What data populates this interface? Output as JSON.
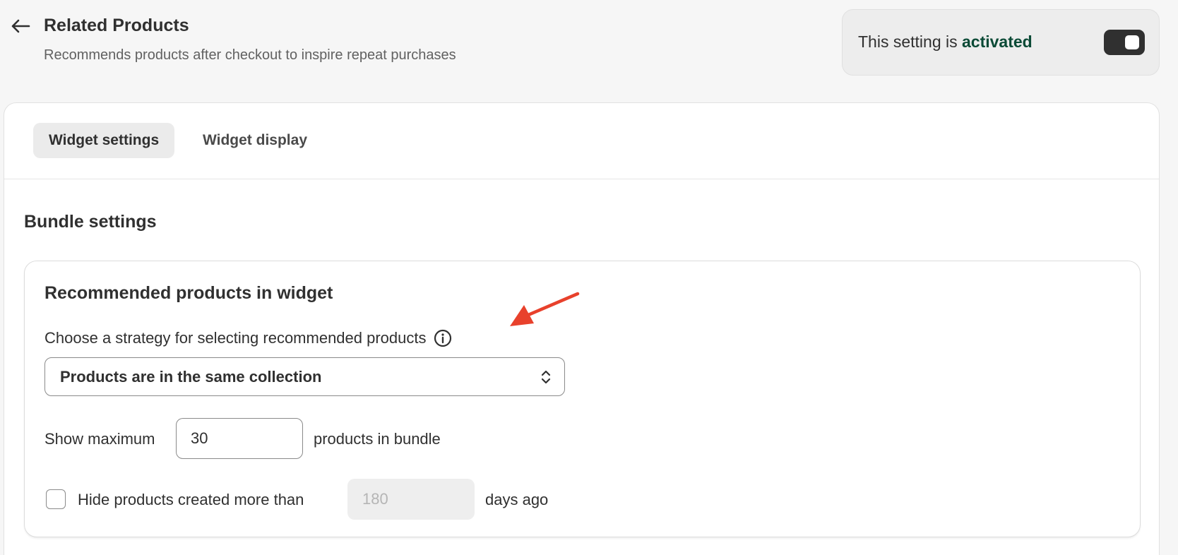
{
  "header": {
    "back_icon": "arrow-left-icon",
    "title": "Related Products",
    "subtitle": "Recommends products after checkout to inspire repeat purchases"
  },
  "status": {
    "text_prefix": "This setting is ",
    "text_strong": "activated",
    "toggle_on": true
  },
  "tabs": [
    {
      "label": "Widget settings",
      "active": true
    },
    {
      "label": "Widget display",
      "active": false
    }
  ],
  "bundle": {
    "section_title": "Bundle settings",
    "card_title": "Recommended products in widget",
    "strategy_label": "Choose a strategy for selecting recommended products",
    "info_icon": "info-circle-icon",
    "strategy_value": "Products are in the same collection",
    "max_label": "Show maximum",
    "max_value": "30",
    "max_suffix": "products in bundle",
    "hide_checked": false,
    "hide_label": "Hide products created more than",
    "hide_days_value": "180",
    "hide_suffix": "days ago"
  },
  "colors": {
    "accent_text": "#0b4a36",
    "annotation_arrow": "#e8412c",
    "toggle_bg": "#303030"
  }
}
